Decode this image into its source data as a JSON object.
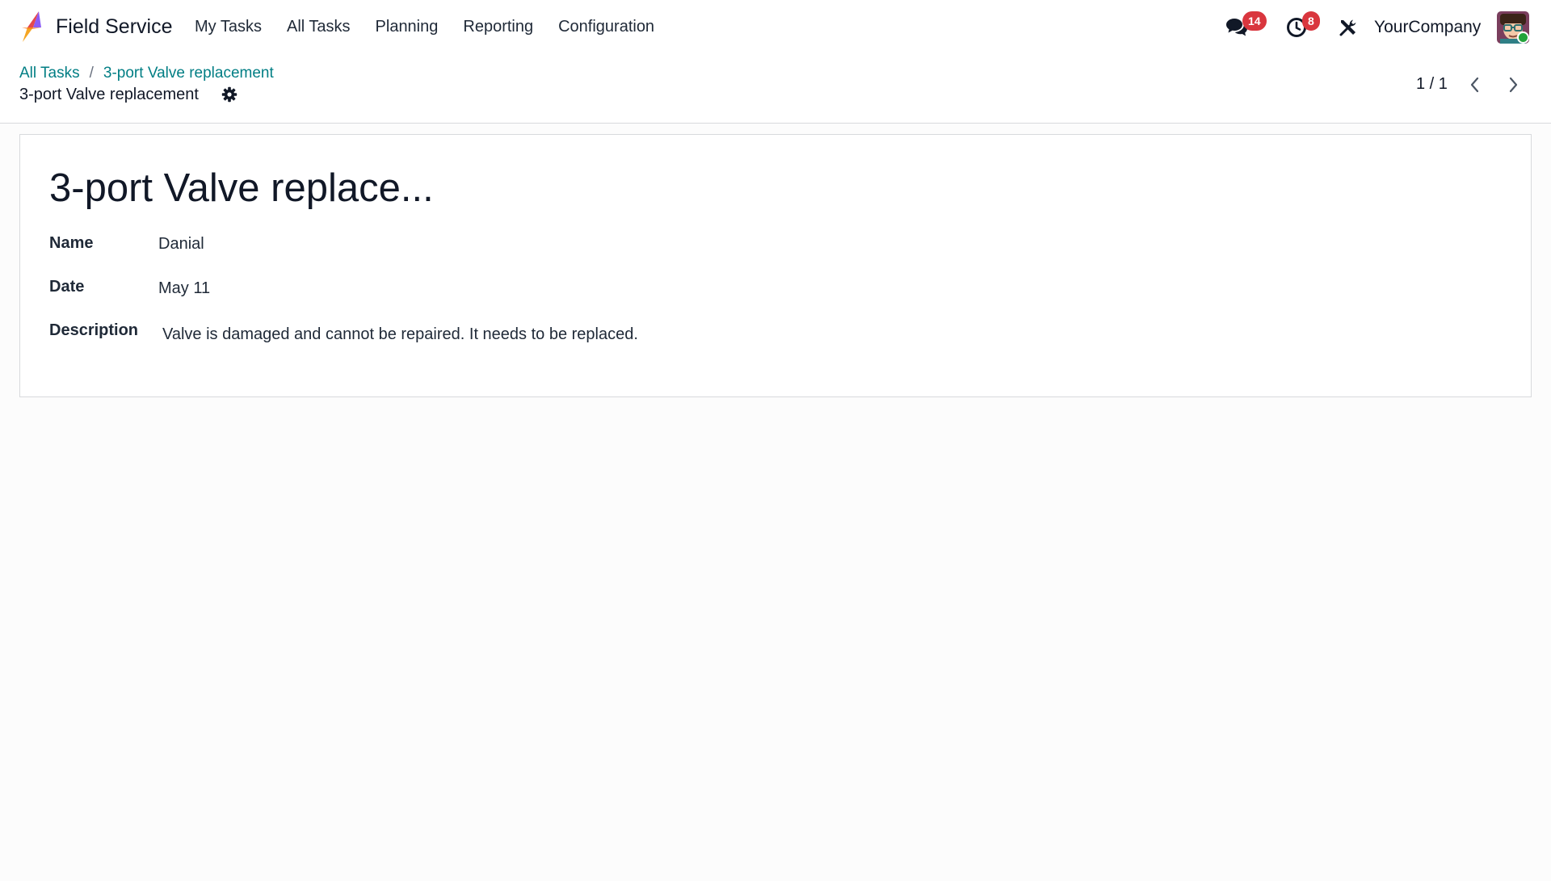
{
  "navbar": {
    "app_name": "Field Service",
    "menu": [
      "My Tasks",
      "All Tasks",
      "Planning",
      "Reporting",
      "Configuration"
    ],
    "messages_count": "14",
    "activities_count": "8",
    "company": "YourCompany"
  },
  "breadcrumb": {
    "parent": "All Tasks",
    "separator": "/",
    "current": "3-port Valve replacement"
  },
  "record_title": "3-port Valve replacement",
  "pager": {
    "value": "1 / 1"
  },
  "form": {
    "title": "3-port Valve replace...",
    "fields": [
      {
        "label": "Name",
        "value": "Danial"
      },
      {
        "label": "Date",
        "value": "May 11"
      },
      {
        "label": "Description",
        "value": "Valve is damaged and cannot be repaired. It needs to be replaced."
      }
    ]
  },
  "colors": {
    "accent_link": "#017e84",
    "badge": "#d9363e",
    "online": "#22a33a"
  },
  "icons": [
    "field-service-logo-icon",
    "messages-icon",
    "activity-clock-icon",
    "debug-tools-icon",
    "gear-icon",
    "chevron-left-icon",
    "chevron-right-icon"
  ]
}
